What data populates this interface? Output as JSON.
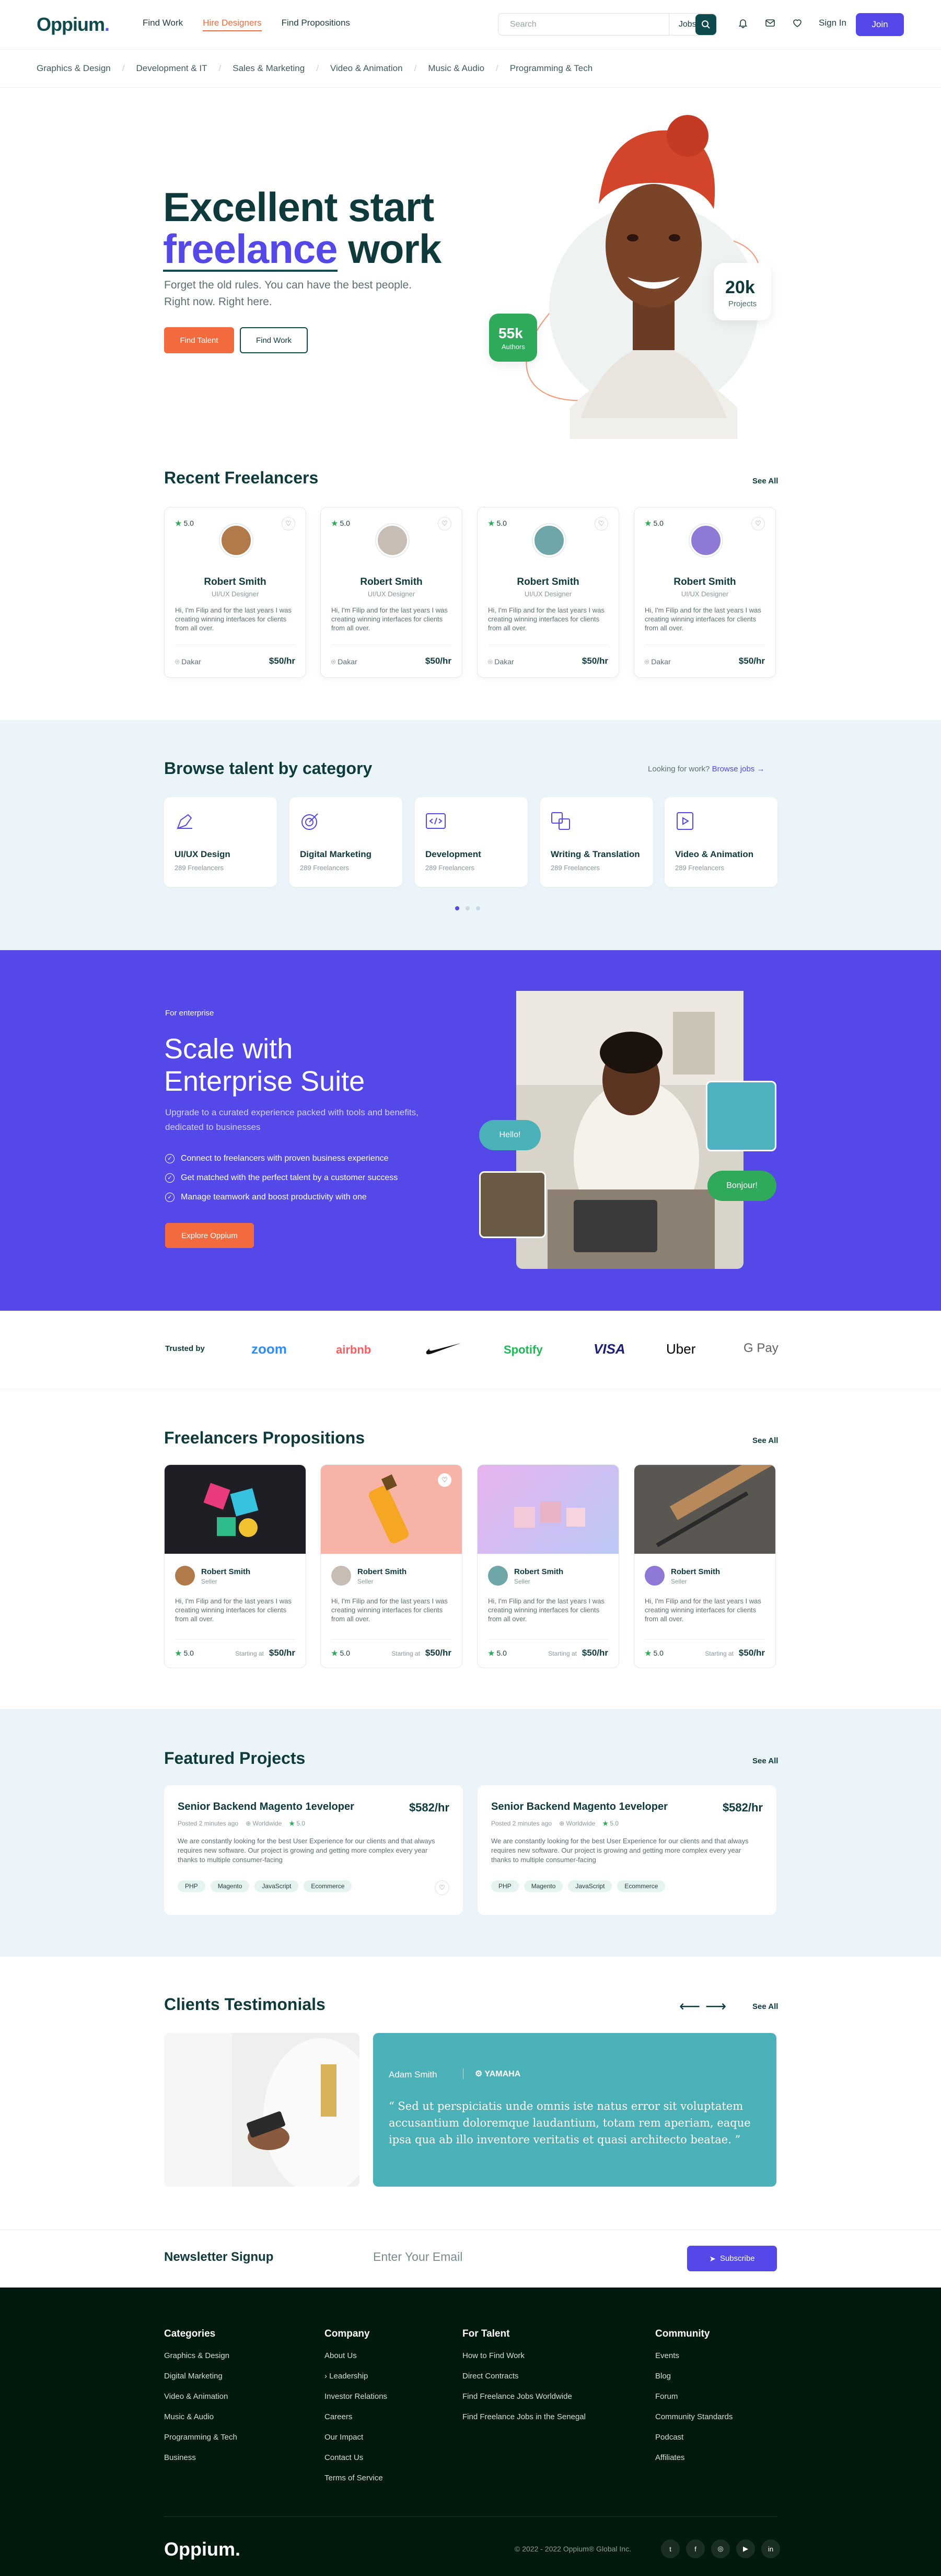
{
  "nav": {
    "logo": "Oppium",
    "links": [
      "Find Work",
      "Hire Designers",
      "Find Propositions"
    ],
    "search_placeholder": "Search",
    "search_type": "Jobs",
    "signin": "Sign In",
    "join": "Join"
  },
  "categories_bar": [
    "Graphics & Design",
    "Development & IT",
    "Sales & Marketing",
    "Video & Animation",
    "Music & Audio",
    "Programming & Tech"
  ],
  "hero": {
    "title_l1": "Excellent start",
    "title_hl": "freelance",
    "title_rest": "work",
    "subtitle": "Forget the old rules. You can have the best people. Right now. Right here.",
    "btn_talent": "Find Talent",
    "btn_work": "Find Work",
    "stat1_value": "20k",
    "stat1_label": "Projects",
    "stat2_value": "55k",
    "stat2_label": "Authors"
  },
  "recent": {
    "title": "Recent Freelancers",
    "see_all": "See All",
    "cards": [
      {
        "rating": "5.0",
        "name": "Robert Smith",
        "role": "UI/UX Designer",
        "desc": "Hi, I'm Filip and for the last years I was creating winning interfaces for clients from all over.",
        "location": "Dakar",
        "rate": "$50/hr",
        "avatar": "#b07a4a"
      },
      {
        "rating": "5.0",
        "name": "Robert Smith",
        "role": "UI/UX Designer",
        "desc": "Hi, I'm Filip and for the last years I was creating winning interfaces for clients from all over.",
        "location": "Dakar",
        "rate": "$50/hr",
        "avatar": "#c7bdb4"
      },
      {
        "rating": "5.0",
        "name": "Robert Smith",
        "role": "UI/UX Designer",
        "desc": "Hi, I'm Filip and for the last years I was creating winning interfaces for clients from all over.",
        "location": "Dakar",
        "rate": "$50/hr",
        "avatar": "#6fa7a8"
      },
      {
        "rating": "5.0",
        "name": "Robert Smith",
        "role": "UI/UX Designer",
        "desc": "Hi, I'm Filip and for the last years I was creating winning interfaces for clients from all over.",
        "location": "Dakar",
        "rate": "$50/hr",
        "avatar": "#8e7ad6"
      }
    ]
  },
  "browse": {
    "title": "Browse talent by category",
    "looking": "Looking for work?",
    "browse_jobs": "Browse jobs",
    "cards": [
      {
        "title": "UI/UX Design",
        "sub": "289 Freelancers"
      },
      {
        "title": "Digital Marketing",
        "sub": "289 Freelancers"
      },
      {
        "title": "Development",
        "sub": "289 Freelancers"
      },
      {
        "title": "Writing & Translation",
        "sub": "289 Freelancers"
      },
      {
        "title": "Video & Animation",
        "sub": "289 Freelancers"
      }
    ]
  },
  "enterprise": {
    "tag": "For enterprise",
    "title_l1": "Scale with",
    "title_l2": "Enterprise Suite",
    "subtitle": "Upgrade to a curated experience packed with tools and benefits, dedicated to businesses",
    "items": [
      "Connect to freelancers with proven business experience",
      "Get matched with the perfect talent by a customer success",
      "Manage teamwork and boost productivity with one"
    ],
    "cta": "Explore Oppium",
    "bubble1": "Hello!",
    "bubble2": "Bonjour!"
  },
  "trusted": {
    "label": "Trusted by",
    "logos": [
      "zoom",
      "airbnb",
      "nike",
      "Spotify",
      "VISA",
      "Uber",
      "G Pay"
    ]
  },
  "propositions": {
    "title": "Freelancers Propositions",
    "see_all": "See All",
    "cards": [
      {
        "name": "Robert Smith",
        "role": "Seller",
        "desc": "Hi, I'm Filip and for the last years I was creating winning interfaces for clients from all over.",
        "rating": "5.0",
        "starting": "Starting at",
        "price": "$50/hr",
        "bg": "#1d1f24"
      },
      {
        "name": "Robert Smith",
        "role": "Seller",
        "desc": "Hi, I'm Filip and for the last years I was creating winning interfaces for clients from all over.",
        "rating": "5.0",
        "starting": "Starting at",
        "price": "$50/hr",
        "bg": "#f7b3a6"
      },
      {
        "name": "Robert Smith",
        "role": "Seller",
        "desc": "Hi, I'm Filip and for the last years I was creating winning interfaces for clients from all over.",
        "rating": "5.0",
        "starting": "Starting at",
        "price": "$50/hr",
        "bg": "#d9b8f1"
      },
      {
        "name": "Robert Smith",
        "role": "Seller",
        "desc": "Hi, I'm Filip and for the last years I was creating winning interfaces for clients from all over.",
        "rating": "5.0",
        "starting": "Starting at",
        "price": "$50/hr",
        "bg": "#5a5752"
      }
    ]
  },
  "featured": {
    "title": "Featured Projects",
    "see_all": "See All",
    "jobs": [
      {
        "title": "Senior Backend Magento 1eveloper",
        "price": "$582/hr",
        "posted": "Posted 2 minutes ago",
        "region": "Worldwide",
        "rating": "5.0",
        "desc": "We are constantly looking for the best User Experience for our clients and that always requires new software. Our project is growing and getting more complex every year thanks to multiple consumer-facing",
        "tags": [
          "PHP",
          "Magento",
          "JavaScript",
          "Ecommerce"
        ]
      },
      {
        "title": "Senior Backend Magento 1eveloper",
        "price": "$582/hr",
        "posted": "Posted 2 minutes ago",
        "region": "Worldwide",
        "rating": "5.0",
        "desc": "We are constantly looking for the best User Experience for our clients and that always requires new software. Our project is growing and getting more complex every year thanks to multiple consumer-facing",
        "tags": [
          "PHP",
          "Magento",
          "JavaScript",
          "Ecommerce"
        ]
      }
    ]
  },
  "testimonials": {
    "title": "Clients Testimonials",
    "see_all": "See All",
    "author": "Adam Smith",
    "company": "YAMAHA",
    "quote": "“ Sed ut perspiciatis unde omnis iste natus error sit voluptatem accusantium doloremque laudantium, totam rem aperiam, eaque ipsa qua ab illo inventore veritatis et quasi architecto beatae. ”"
  },
  "newsletter": {
    "title": "Newsletter Signup",
    "placeholder": "Enter Your Email",
    "button": "Subscribe"
  },
  "footer": {
    "categories": {
      "title": "Categories",
      "links": [
        "Graphics & Design",
        "Digital Marketing",
        "Video & Animation",
        "Music & Audio",
        "Programming & Tech",
        "Business"
      ]
    },
    "company": {
      "title": "Company",
      "links": [
        "About Us",
        "Leadership",
        "Investor Relations",
        "Careers",
        "Our Impact",
        "Contact Us",
        "Terms of Service"
      ]
    },
    "talent": {
      "title": "For Talent",
      "links": [
        "How to Find Work",
        "Direct Contracts",
        "Find Freelance Jobs Worldwide",
        "Find Freelance Jobs in the Senegal"
      ]
    },
    "community": {
      "title": "Community",
      "links": [
        "Events",
        "Blog",
        "Forum",
        "Community Standards",
        "Podcast",
        "Affiliates"
      ]
    },
    "logo": "Oppium.",
    "copyright": "© 2022 - 2022 Oppium® Global Inc."
  },
  "colors": {
    "brand_purple": "#5448e8",
    "accent_orange": "#f26a3d",
    "dark_teal": "#0f4a4d",
    "footer_bg": "#021a0d",
    "testimonial_bg": "#4ab1b9"
  }
}
